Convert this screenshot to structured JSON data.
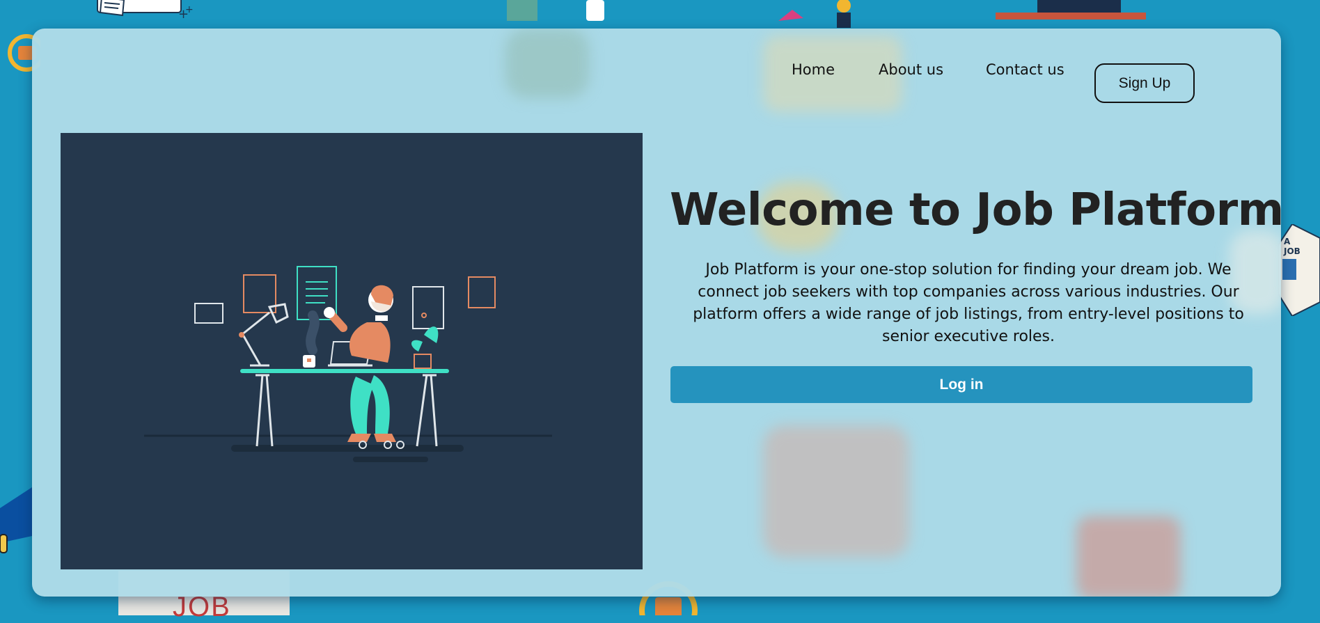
{
  "nav": {
    "home": "Home",
    "about": "About us",
    "contact": "Contact us",
    "signup": "Sign Up"
  },
  "hero": {
    "title": "Welcome to Job Platform",
    "description": "Job Platform is your one-stop solution for finding your dream job. We connect job seekers with top companies across various industries. Our platform offers a wide range of job listings, from entry-level positions to senior executive roles.",
    "login_label": "Log in",
    "illustration": "person-working-at-desk-illustration"
  },
  "background": {
    "logo_text": "JOB",
    "badge_text": "A JOB"
  },
  "colors": {
    "page_bg": "#1a97c1",
    "card_bg": "#aedbe8",
    "login_button": "#2593be",
    "illustration_bg": "#25384d",
    "accent_teal": "#3fe0c5",
    "accent_orange": "#e58a62"
  }
}
